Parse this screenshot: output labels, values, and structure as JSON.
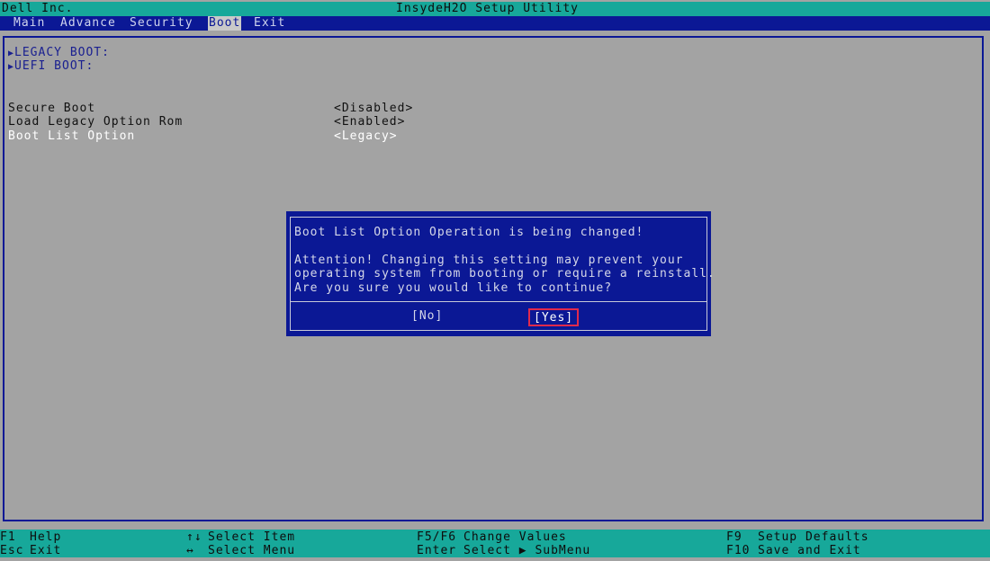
{
  "title_bar": {
    "vendor": "Dell Inc.",
    "utility": "InsydeH2O Setup Utility"
  },
  "menu": {
    "tabs": [
      {
        "label": "Main"
      },
      {
        "label": "Advance"
      },
      {
        "label": "Security"
      },
      {
        "label": "Boot"
      },
      {
        "label": "Exit"
      }
    ],
    "active": "Boot"
  },
  "boot": {
    "submenus": [
      {
        "arrow": "▶",
        "label": "LEGACY BOOT:"
      },
      {
        "arrow": "▶",
        "label": "UEFI BOOT:"
      }
    ],
    "settings": [
      {
        "label": "Secure Boot",
        "value": "<Disabled>"
      },
      {
        "label": "Load Legacy Option Rom",
        "value": "<Enabled>"
      },
      {
        "label": "Boot List Option",
        "value": "<Legacy>"
      }
    ],
    "selected": "Boot List Option"
  },
  "dialog": {
    "title": "Boot List Option Operation is being changed!",
    "message_lines": [
      "Attention! Changing this setting may prevent your",
      "operating system from booting or require a reinstall.",
      "Are you sure you would like to continue?"
    ],
    "no_label": "[No]",
    "yes_label": "[Yes]",
    "selected_button": "[Yes]"
  },
  "footer": {
    "keys": [
      {
        "key": "F1",
        "action": "Help"
      },
      {
        "key": "Esc",
        "action": "Exit"
      },
      {
        "key": "↑↓",
        "action": "Select Item"
      },
      {
        "key": "↔",
        "action": "Select Menu"
      },
      {
        "key": "F5/F6",
        "action": "Change Values"
      },
      {
        "key": "Enter",
        "action": "Select ▶ SubMenu"
      },
      {
        "key": "F9",
        "action": "Setup Defaults"
      },
      {
        "key": "F10",
        "action": "Save and Exit"
      }
    ]
  },
  "colors": {
    "background": "#a3a3a3",
    "bars": "#17a89a",
    "menu_bar": "#0b1895",
    "dialog": "#0b1895",
    "selection_outline": "#e02a4c"
  }
}
